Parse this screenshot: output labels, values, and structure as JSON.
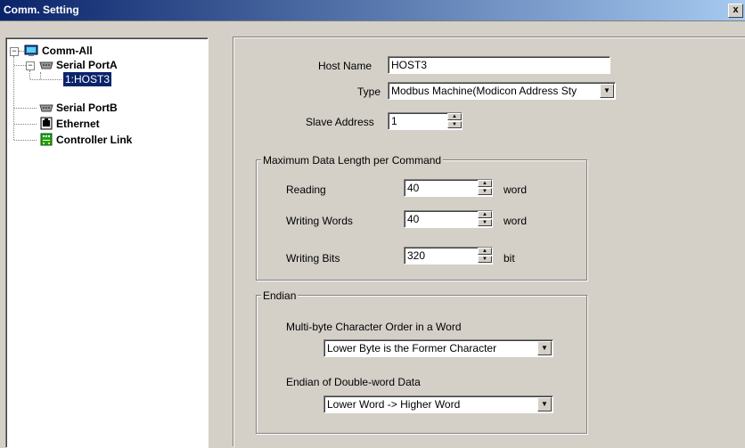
{
  "window": {
    "title": "Comm. Setting",
    "close_glyph": "x"
  },
  "tree": {
    "root": "Comm-All",
    "items": [
      {
        "label": "Serial PortA"
      },
      {
        "label": "1:HOST3"
      },
      {
        "label": "Serial PortB"
      },
      {
        "label": "Ethernet"
      },
      {
        "label": "Controller Link"
      }
    ],
    "expand_glyph": "−"
  },
  "form": {
    "host_name_label": "Host Name",
    "host_name_value": "HOST3",
    "type_label": "Type",
    "type_value": "Modbus Machine(Modicon Address Sty",
    "slave_label": "Slave Address",
    "slave_value": "1"
  },
  "maxlen": {
    "title": "Maximum Data Length per Command",
    "rows": [
      {
        "label": "Reading",
        "value": "40",
        "unit": "word"
      },
      {
        "label": "Writing Words",
        "value": "40",
        "unit": "word"
      },
      {
        "label": "Writing Bits",
        "value": "320",
        "unit": "bit"
      }
    ]
  },
  "endian": {
    "title": "Endian",
    "char_order_label": "Multi-byte Character Order in a Word",
    "char_order_value": "Lower Byte is the Former Character",
    "dword_label": "Endian of Double-word Data",
    "dword_value": "Lower Word -> Higher Word"
  },
  "glyphs": {
    "up": "▲",
    "down": "▼"
  },
  "colors": {
    "title_start": "#0a246a",
    "title_end": "#a6caf0",
    "face": "#d4d0c8",
    "selection": "#0a246a"
  }
}
